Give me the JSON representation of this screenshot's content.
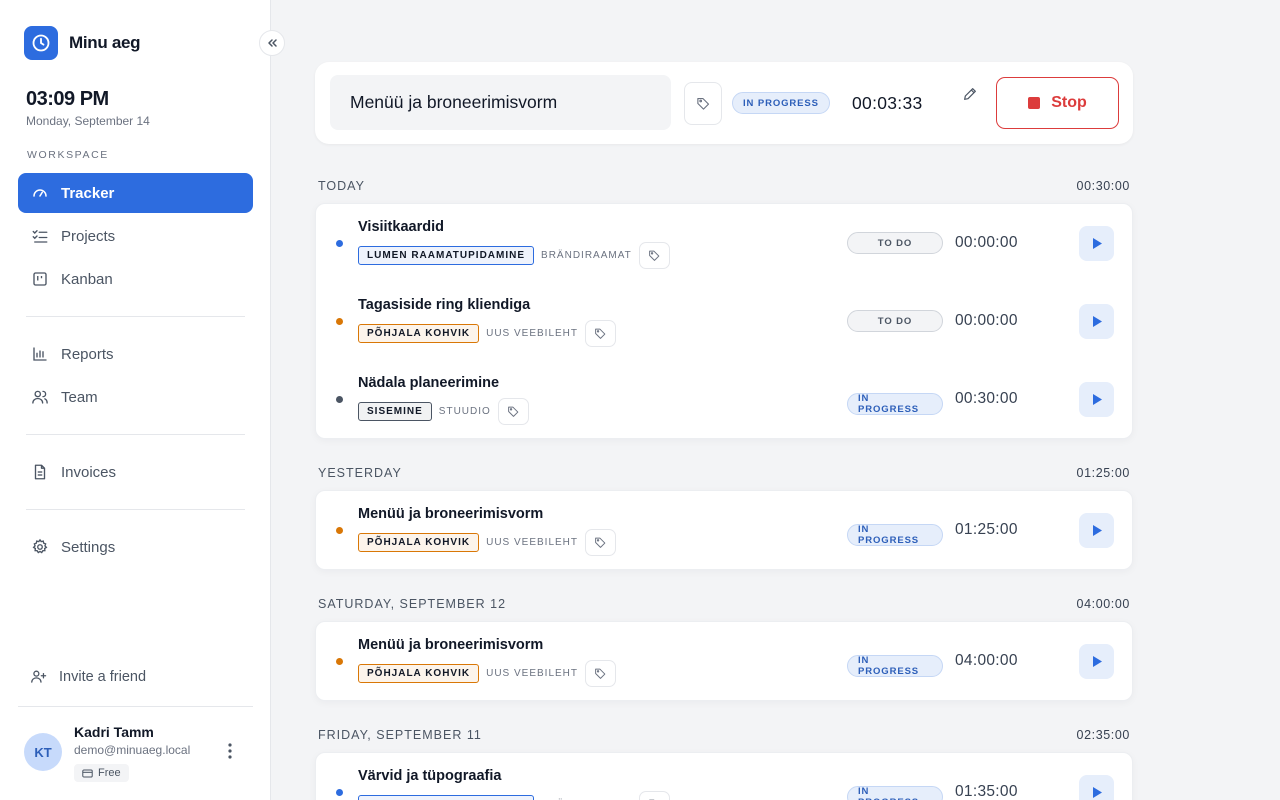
{
  "app": {
    "name": "Minu aeg"
  },
  "clock": {
    "time": "03:09 PM",
    "date": "Monday, September 14"
  },
  "sidebar": {
    "section_label": "WORKSPACE",
    "items": [
      {
        "label": "Tracker",
        "icon": "gauge-icon",
        "active": true
      },
      {
        "label": "Projects",
        "icon": "checklist-icon"
      },
      {
        "label": "Kanban",
        "icon": "kanban-icon"
      },
      {
        "label": "Reports",
        "icon": "bar-chart-icon"
      },
      {
        "label": "Team",
        "icon": "users-icon"
      },
      {
        "label": "Invoices",
        "icon": "document-icon"
      },
      {
        "label": "Settings",
        "icon": "gear-icon"
      }
    ],
    "invite_label": "Invite a friend",
    "user": {
      "initials": "KT",
      "name": "Kadri Tamm",
      "email": "demo@minuaeg.local",
      "plan": "Free"
    }
  },
  "running": {
    "title": "Menüü ja broneerimisvorm",
    "status": "IN PROGRESS",
    "timer": "00:03:33",
    "stop_label": "Stop"
  },
  "colors": {
    "accent": "#2d6cdf",
    "stop": "#dc3c3c"
  },
  "groups": [
    {
      "label": "TODAY",
      "total": "00:30:00",
      "entries": [
        {
          "title": "Visiitkaardid",
          "client": "LUMEN RAAMATUPIDAMINE",
          "client_color": "#2d6cdf",
          "project": "BRÄNDIRAAMAT",
          "status": "TO DO",
          "status_type": "todo",
          "duration": "00:00:00"
        },
        {
          "title": "Tagasiside ring kliendiga",
          "client": "PÕHJALA KOHVIK",
          "client_color": "#d97706",
          "project": "UUS VEEBILEHT",
          "status": "TO DO",
          "status_type": "todo",
          "duration": "00:00:00"
        },
        {
          "title": "Nädala planeerimine",
          "client": "SISEMINE",
          "client_color": "#4b5563",
          "project": "STUUDIO",
          "status": "IN PROGRESS",
          "status_type": "progress",
          "duration": "00:30:00"
        }
      ]
    },
    {
      "label": "YESTERDAY",
      "total": "01:25:00",
      "entries": [
        {
          "title": "Menüü ja broneerimisvorm",
          "client": "PÕHJALA KOHVIK",
          "client_color": "#d97706",
          "project": "UUS VEEBILEHT",
          "status": "IN PROGRESS",
          "status_type": "progress",
          "duration": "01:25:00"
        }
      ]
    },
    {
      "label": "SATURDAY, SEPTEMBER 12",
      "total": "04:00:00",
      "entries": [
        {
          "title": "Menüü ja broneerimisvorm",
          "client": "PÕHJALA KOHVIK",
          "client_color": "#d97706",
          "project": "UUS VEEBILEHT",
          "status": "IN PROGRESS",
          "status_type": "progress",
          "duration": "04:00:00"
        }
      ]
    },
    {
      "label": "FRIDAY, SEPTEMBER 11",
      "total": "02:35:00",
      "entries": [
        {
          "title": "Värvid ja tüpograafia",
          "client": "LUMEN RAAMATUPIDAMINE",
          "client_color": "#2d6cdf",
          "project": "BRÄNDIRAAMAT",
          "status": "IN PROGRESS",
          "status_type": "progress",
          "duration": "01:35:00"
        }
      ]
    }
  ]
}
